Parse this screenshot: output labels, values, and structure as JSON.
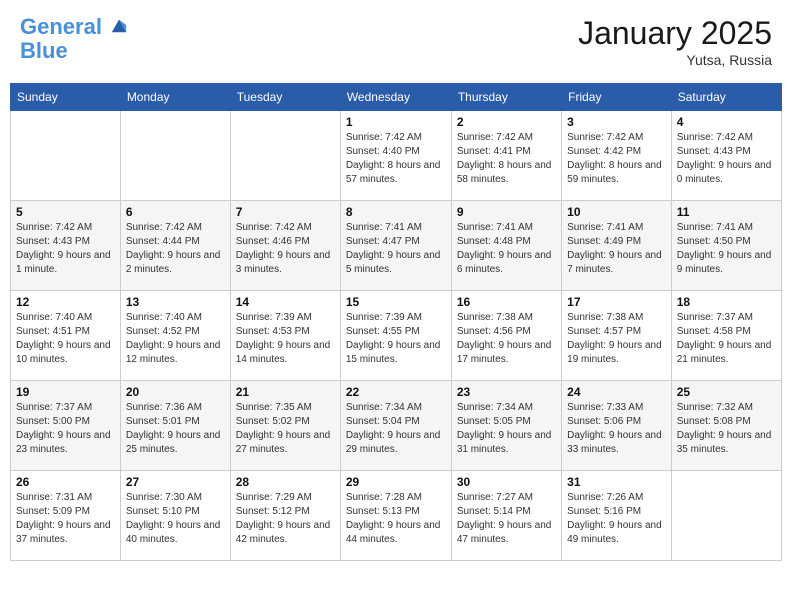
{
  "header": {
    "logo_line1": "General",
    "logo_line2": "Blue",
    "month": "January 2025",
    "location": "Yutsa, Russia"
  },
  "weekdays": [
    "Sunday",
    "Monday",
    "Tuesday",
    "Wednesday",
    "Thursday",
    "Friday",
    "Saturday"
  ],
  "weeks": [
    [
      {
        "day": "",
        "info": ""
      },
      {
        "day": "",
        "info": ""
      },
      {
        "day": "",
        "info": ""
      },
      {
        "day": "1",
        "info": "Sunrise: 7:42 AM\nSunset: 4:40 PM\nDaylight: 8 hours and 57 minutes."
      },
      {
        "day": "2",
        "info": "Sunrise: 7:42 AM\nSunset: 4:41 PM\nDaylight: 8 hours and 58 minutes."
      },
      {
        "day": "3",
        "info": "Sunrise: 7:42 AM\nSunset: 4:42 PM\nDaylight: 8 hours and 59 minutes."
      },
      {
        "day": "4",
        "info": "Sunrise: 7:42 AM\nSunset: 4:43 PM\nDaylight: 9 hours and 0 minutes."
      }
    ],
    [
      {
        "day": "5",
        "info": "Sunrise: 7:42 AM\nSunset: 4:43 PM\nDaylight: 9 hours and 1 minute."
      },
      {
        "day": "6",
        "info": "Sunrise: 7:42 AM\nSunset: 4:44 PM\nDaylight: 9 hours and 2 minutes."
      },
      {
        "day": "7",
        "info": "Sunrise: 7:42 AM\nSunset: 4:46 PM\nDaylight: 9 hours and 3 minutes."
      },
      {
        "day": "8",
        "info": "Sunrise: 7:41 AM\nSunset: 4:47 PM\nDaylight: 9 hours and 5 minutes."
      },
      {
        "day": "9",
        "info": "Sunrise: 7:41 AM\nSunset: 4:48 PM\nDaylight: 9 hours and 6 minutes."
      },
      {
        "day": "10",
        "info": "Sunrise: 7:41 AM\nSunset: 4:49 PM\nDaylight: 9 hours and 7 minutes."
      },
      {
        "day": "11",
        "info": "Sunrise: 7:41 AM\nSunset: 4:50 PM\nDaylight: 9 hours and 9 minutes."
      }
    ],
    [
      {
        "day": "12",
        "info": "Sunrise: 7:40 AM\nSunset: 4:51 PM\nDaylight: 9 hours and 10 minutes."
      },
      {
        "day": "13",
        "info": "Sunrise: 7:40 AM\nSunset: 4:52 PM\nDaylight: 9 hours and 12 minutes."
      },
      {
        "day": "14",
        "info": "Sunrise: 7:39 AM\nSunset: 4:53 PM\nDaylight: 9 hours and 14 minutes."
      },
      {
        "day": "15",
        "info": "Sunrise: 7:39 AM\nSunset: 4:55 PM\nDaylight: 9 hours and 15 minutes."
      },
      {
        "day": "16",
        "info": "Sunrise: 7:38 AM\nSunset: 4:56 PM\nDaylight: 9 hours and 17 minutes."
      },
      {
        "day": "17",
        "info": "Sunrise: 7:38 AM\nSunset: 4:57 PM\nDaylight: 9 hours and 19 minutes."
      },
      {
        "day": "18",
        "info": "Sunrise: 7:37 AM\nSunset: 4:58 PM\nDaylight: 9 hours and 21 minutes."
      }
    ],
    [
      {
        "day": "19",
        "info": "Sunrise: 7:37 AM\nSunset: 5:00 PM\nDaylight: 9 hours and 23 minutes."
      },
      {
        "day": "20",
        "info": "Sunrise: 7:36 AM\nSunset: 5:01 PM\nDaylight: 9 hours and 25 minutes."
      },
      {
        "day": "21",
        "info": "Sunrise: 7:35 AM\nSunset: 5:02 PM\nDaylight: 9 hours and 27 minutes."
      },
      {
        "day": "22",
        "info": "Sunrise: 7:34 AM\nSunset: 5:04 PM\nDaylight: 9 hours and 29 minutes."
      },
      {
        "day": "23",
        "info": "Sunrise: 7:34 AM\nSunset: 5:05 PM\nDaylight: 9 hours and 31 minutes."
      },
      {
        "day": "24",
        "info": "Sunrise: 7:33 AM\nSunset: 5:06 PM\nDaylight: 9 hours and 33 minutes."
      },
      {
        "day": "25",
        "info": "Sunrise: 7:32 AM\nSunset: 5:08 PM\nDaylight: 9 hours and 35 minutes."
      }
    ],
    [
      {
        "day": "26",
        "info": "Sunrise: 7:31 AM\nSunset: 5:09 PM\nDaylight: 9 hours and 37 minutes."
      },
      {
        "day": "27",
        "info": "Sunrise: 7:30 AM\nSunset: 5:10 PM\nDaylight: 9 hours and 40 minutes."
      },
      {
        "day": "28",
        "info": "Sunrise: 7:29 AM\nSunset: 5:12 PM\nDaylight: 9 hours and 42 minutes."
      },
      {
        "day": "29",
        "info": "Sunrise: 7:28 AM\nSunset: 5:13 PM\nDaylight: 9 hours and 44 minutes."
      },
      {
        "day": "30",
        "info": "Sunrise: 7:27 AM\nSunset: 5:14 PM\nDaylight: 9 hours and 47 minutes."
      },
      {
        "day": "31",
        "info": "Sunrise: 7:26 AM\nSunset: 5:16 PM\nDaylight: 9 hours and 49 minutes."
      },
      {
        "day": "",
        "info": ""
      }
    ]
  ]
}
